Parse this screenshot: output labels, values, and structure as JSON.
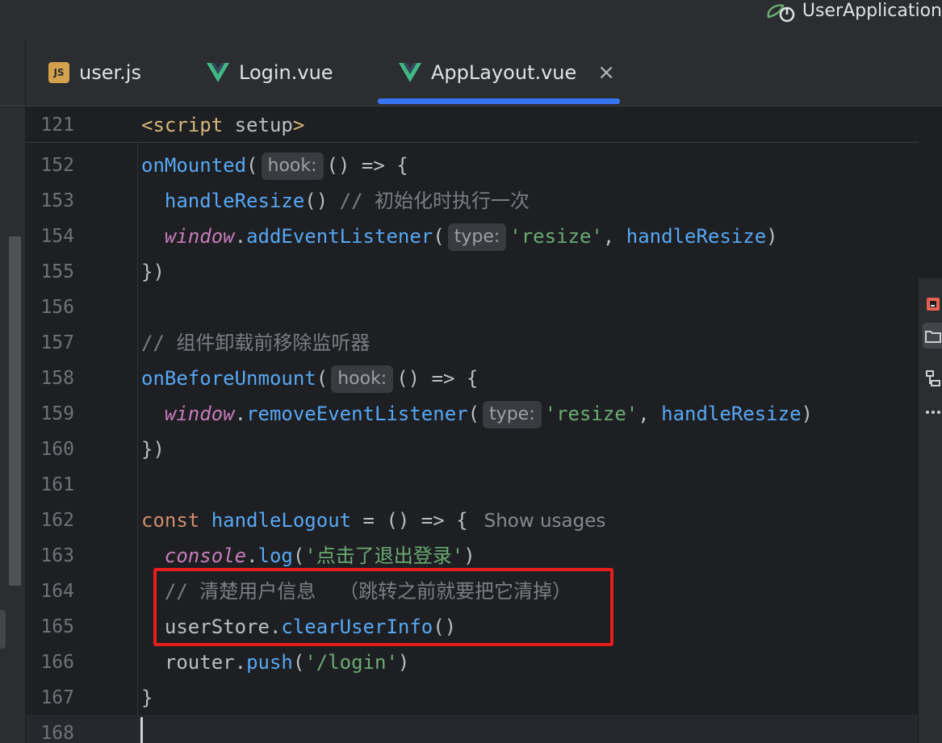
{
  "titlebar": {
    "run_config_label": "UserApplication"
  },
  "tabs": [
    {
      "label": "user.js",
      "icon": "js-icon"
    },
    {
      "label": "Login.vue",
      "icon": "vue-icon"
    },
    {
      "label": "AppLayout.vue",
      "icon": "vue-icon",
      "active": true
    }
  ],
  "editor": {
    "sticky": {
      "num": "121"
    },
    "lines": [
      {
        "num": "152"
      },
      {
        "num": "153"
      },
      {
        "num": "154"
      },
      {
        "num": "155"
      },
      {
        "num": "156"
      },
      {
        "num": "157"
      },
      {
        "num": "158"
      },
      {
        "num": "159"
      },
      {
        "num": "160"
      },
      {
        "num": "161"
      },
      {
        "num": "162"
      },
      {
        "num": "163"
      },
      {
        "num": "164"
      },
      {
        "num": "165"
      },
      {
        "num": "166"
      },
      {
        "num": "167"
      },
      {
        "num": "168"
      }
    ],
    "tokens": {
      "l121_open": "<script",
      "l121_attr": " setup",
      "l121_close": ">",
      "l152_fn": "onMounted",
      "l152_p": "(",
      "l152_hint": "hook:",
      "l152_rest": "() => {",
      "l153_indent": "  ",
      "l153_fn": "handleResize",
      "l153_rest": "() ",
      "l153_cmt": "// 初始化时执行一次",
      "l154_indent": "  ",
      "l154_win": "window",
      "l154_dot": ".",
      "l154_fn": "addEventListener",
      "l154_p": "(",
      "l154_hint": "type:",
      "l154_str": "'resize'",
      "l154_comma": ", ",
      "l154_arg": "handleResize",
      "l154_close": ")",
      "l155": "})",
      "l157_cmt": "// 组件卸载前移除监听器",
      "l158_fn": "onBeforeUnmount",
      "l158_p": "(",
      "l158_hint": "hook:",
      "l158_rest": "() => {",
      "l159_indent": "  ",
      "l159_win": "window",
      "l159_dot": ".",
      "l159_fn": "removeEventListener",
      "l159_p": "(",
      "l159_hint": "type:",
      "l159_str": "'resize'",
      "l159_comma": ", ",
      "l159_arg": "handleResize",
      "l159_close": ")",
      "l160": "})",
      "l162_kw": "const ",
      "l162_fn": "handleLogout",
      "l162_rest": " = () => {",
      "l162_usage": "Show usages",
      "l163_indent": "  ",
      "l163_obj": "console",
      "l163_dot": ".",
      "l163_fn": "log",
      "l163_p": "(",
      "l163_str": "'点击了退出登录'",
      "l163_close": ")",
      "l164_indent": "  ",
      "l164_cmt": "// 清楚用户信息  （跳转之前就要把它清掉）",
      "l165_indent": "  ",
      "l165_obj": "userStore.",
      "l165_fn": "clearUserInfo",
      "l165_rest": "()",
      "l166_indent": "  ",
      "l166_obj": "router.",
      "l166_fn": "push",
      "l166_p": "(",
      "l166_str": "'/login'",
      "l166_close": ")",
      "l167": "}"
    }
  }
}
